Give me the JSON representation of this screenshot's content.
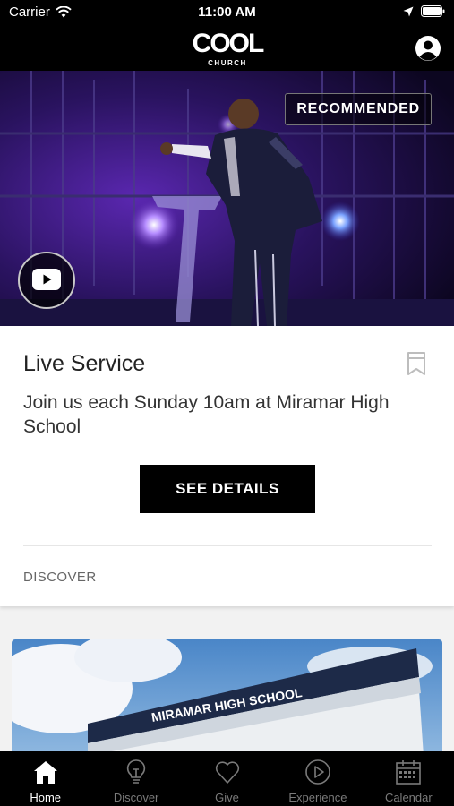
{
  "status_bar": {
    "carrier": "Carrier",
    "time": "11:00 AM"
  },
  "header": {
    "logo_text": "COOL",
    "logo_subtext": "CHURCH",
    "profile_icon": "user-circle-icon"
  },
  "hero": {
    "badge": "RECOMMENDED",
    "play_icon": "youtube-play-icon"
  },
  "card": {
    "title": "Live Service",
    "description": "Join us each Sunday 10am at Miramar High School",
    "button_label": "SEE DETAILS",
    "bookmark_icon": "bookmark-icon"
  },
  "section": {
    "label": "DISCOVER"
  },
  "discover_card": {
    "sign_text": "MIRAMAR HIGH SCHOOL"
  },
  "tabs": [
    {
      "label": "Home",
      "icon": "home-icon",
      "active": true
    },
    {
      "label": "Discover",
      "icon": "lightbulb-icon",
      "active": false
    },
    {
      "label": "Give",
      "icon": "heart-icon",
      "active": false
    },
    {
      "label": "Experience",
      "icon": "play-circle-icon",
      "active": false
    },
    {
      "label": "Calendar",
      "icon": "calendar-icon",
      "active": false
    }
  ]
}
